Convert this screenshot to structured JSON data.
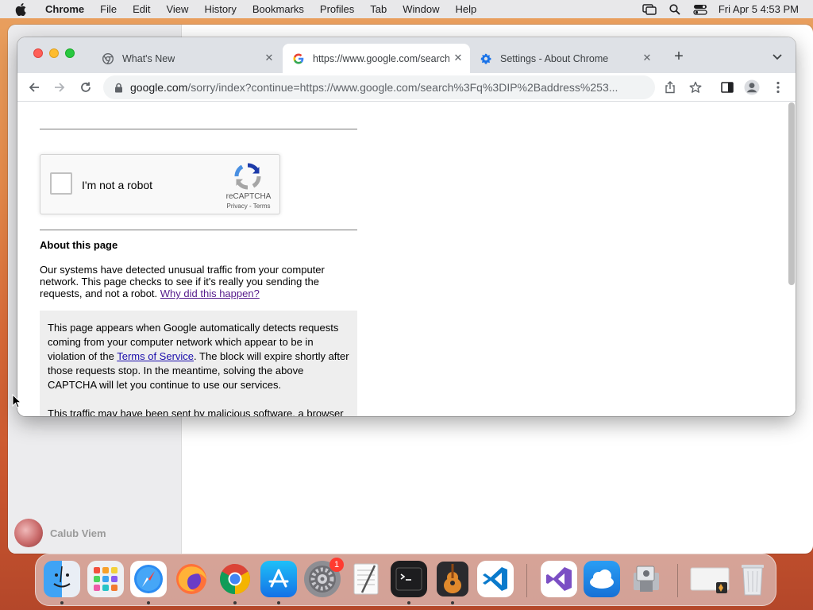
{
  "menubar": {
    "app_name": "Chrome",
    "items": [
      "File",
      "Edit",
      "View",
      "History",
      "Bookmarks",
      "Profiles",
      "Tab",
      "Window",
      "Help"
    ],
    "clock": "Fri Apr 5  4:53 PM"
  },
  "background_window": {
    "user_name": "Calub Viem"
  },
  "chrome": {
    "tabs": [
      {
        "title": "What's New",
        "favicon": "chrome-icon",
        "active": false
      },
      {
        "title": "https://www.google.com/search",
        "favicon": "google-icon",
        "active": true
      },
      {
        "title": "Settings - About Chrome",
        "favicon": "gear-icon",
        "active": false
      }
    ],
    "omnibox": {
      "host": "google.com",
      "path": "/sorry/index?continue=https://www.google.com/search%3Fq%3DIP%2Baddress%253..."
    }
  },
  "page": {
    "captcha": {
      "label": "I'm not a robot",
      "brand": "reCAPTCHA",
      "links": "Privacy - Terms"
    },
    "about_heading": "About this page",
    "about_text": "Our systems have detected unusual traffic from your computer network. This page checks to see if it's really you sending the requests, and not a robot. ",
    "about_link": "Why did this happen?",
    "info_text_1": "This page appears when Google automatically detects requests coming from your computer network which appear to be in violation of the ",
    "info_link": "Terms of Service",
    "info_text_2": ". The block will expire shortly after those requests stop. In the meantime, solving the above CAPTCHA will let you continue to use our services.",
    "info_text_3": "This traffic may have been sent by malicious software, a browser"
  },
  "dock": {
    "apps": [
      "finder",
      "launchpad",
      "safari",
      "firefox",
      "chrome",
      "app-store",
      "system-preferences",
      "textedit",
      "terminal",
      "garageband",
      "vscode",
      "visual-studio",
      "weather-app",
      "migration-assistant",
      "documents",
      "trash"
    ],
    "settings_badge": "1"
  },
  "colors": {
    "accent": "#1a73e8",
    "link_visited": "#551a8b",
    "link": "#1a0dab"
  }
}
